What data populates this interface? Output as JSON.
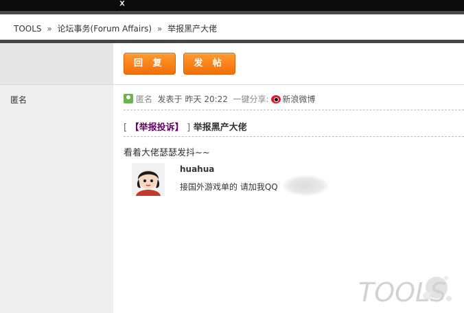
{
  "breadcrumb": {
    "root": "TOOLS",
    "separator": "»",
    "forum": "论坛事务(Forum Affairs)",
    "thread": "举报黑产大佬"
  },
  "sidebar": {
    "author_name": "匿名"
  },
  "toolbar": {
    "reply_label": "回 复",
    "post_label": "发 帖"
  },
  "post": {
    "author": "匿名",
    "posted_label": "发表于",
    "posted_time": "昨天 20:22",
    "share_label": "一键分享:",
    "share_target": "新浪微博",
    "category": "【举报投诉】",
    "title": "举报黑产大佬",
    "body": "看着大佬瑟瑟发抖~~",
    "quote": {
      "username": "huahua",
      "text": "接国外游戏单的 请加我QQ"
    }
  },
  "watermark": {
    "text": "TOOLS"
  },
  "colors": {
    "button": "#f36f0a",
    "category": "#660066",
    "weibo": "#e6162d"
  }
}
